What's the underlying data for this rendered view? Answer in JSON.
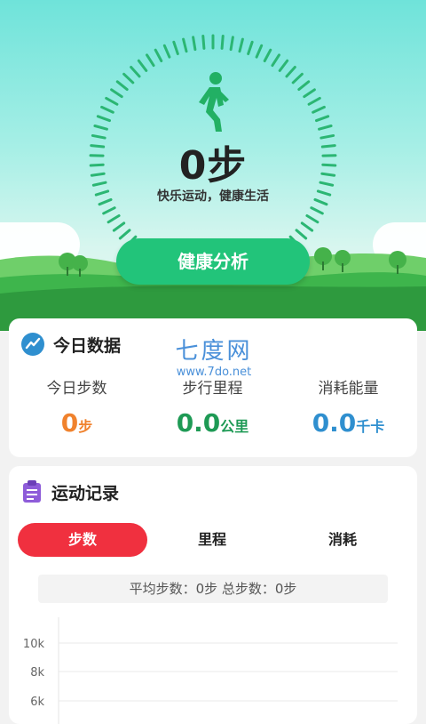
{
  "hero": {
    "step_count": "0步",
    "slogan": "快乐运动，健康生活",
    "analyze_button": "健康分析"
  },
  "today": {
    "title": "今日数据",
    "watermark_logo": "七度网",
    "watermark_url": "www.7do.net",
    "stats": [
      {
        "label": "今日步数",
        "value": "0",
        "unit": "步",
        "color": "#f0822d"
      },
      {
        "label": "步行里程",
        "value": "0.0",
        "unit": "公里",
        "color": "#1e9a55"
      },
      {
        "label": "消耗能量",
        "value": "0.0",
        "unit": "千卡",
        "color": "#2f8fcf"
      }
    ]
  },
  "record": {
    "title": "运动记录",
    "tabs": [
      {
        "label": "步数",
        "active": true
      },
      {
        "label": "里程",
        "active": false
      },
      {
        "label": "消耗",
        "active": false
      }
    ],
    "summary": "平均步数：0步 总步数：0步",
    "y_ticks": [
      "10k",
      "8k",
      "6k"
    ]
  },
  "colors": {
    "accent_green": "#22c47a",
    "tab_red": "#f0303f",
    "stats_icon_blue": "#2f8fcf",
    "record_icon_purple": "#8e5cd9"
  }
}
